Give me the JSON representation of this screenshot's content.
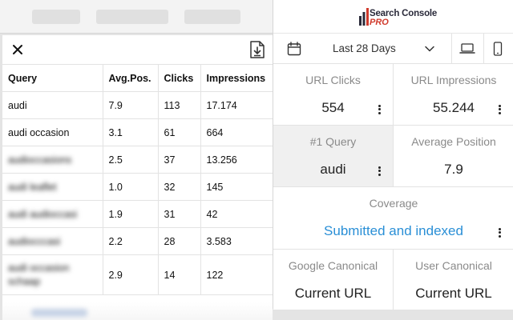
{
  "query_panel": {
    "close_icon": "close-icon",
    "download_icon": "download-icon",
    "columns": [
      "Query",
      "Avg.Pos.",
      "Clicks",
      "Impressions"
    ],
    "rows": [
      {
        "query": "audi",
        "avg_pos": "7.9",
        "clicks": "113",
        "impressions": "17.174"
      },
      {
        "query": "audi occasion",
        "avg_pos": "3.1",
        "clicks": "61",
        "impressions": "664"
      },
      {
        "query": "audioccasions",
        "avg_pos": "2.5",
        "clicks": "37",
        "impressions": "13.256"
      },
      {
        "query": "audi leaflet",
        "avg_pos": "1.0",
        "clicks": "32",
        "impressions": "145"
      },
      {
        "query": "audi audioccasi",
        "avg_pos": "1.9",
        "clicks": "31",
        "impressions": "42"
      },
      {
        "query": "audiocccasi",
        "avg_pos": "2.2",
        "clicks": "28",
        "impressions": "3.583"
      },
      {
        "query": "audi occasion schaap",
        "avg_pos": "2.9",
        "clicks": "14",
        "impressions": "122"
      }
    ]
  },
  "extension": {
    "logo": {
      "line1": "Search Console",
      "line2": "PRO"
    },
    "date_range": "Last 28 Days",
    "icons": {
      "calendar": "calendar-icon",
      "chevron": "chevron-down-icon",
      "desktop": "desktop-icon",
      "mobile": "mobile-icon",
      "menu": "kebab-menu-icon"
    },
    "stats": {
      "url_clicks": {
        "label": "URL Clicks",
        "value": "554"
      },
      "url_impressions": {
        "label": "URL Impressions",
        "value": "55.244"
      },
      "top_query": {
        "label": "#1 Query",
        "value": "audi"
      },
      "average_position": {
        "label": "Average Position",
        "value": "7.9"
      },
      "coverage": {
        "label": "Coverage",
        "value": "Submitted and indexed"
      },
      "google_canonical": {
        "label": "Google Canonical",
        "value": "Current URL"
      },
      "user_canonical": {
        "label": "User Canonical",
        "value": "Current URL"
      }
    }
  },
  "colors": {
    "link_blue": "#2a8fd6",
    "logo_red": "#d03a2c",
    "logo_dark": "#2a2a3a",
    "highlight_cell": "#f0f0f0"
  }
}
